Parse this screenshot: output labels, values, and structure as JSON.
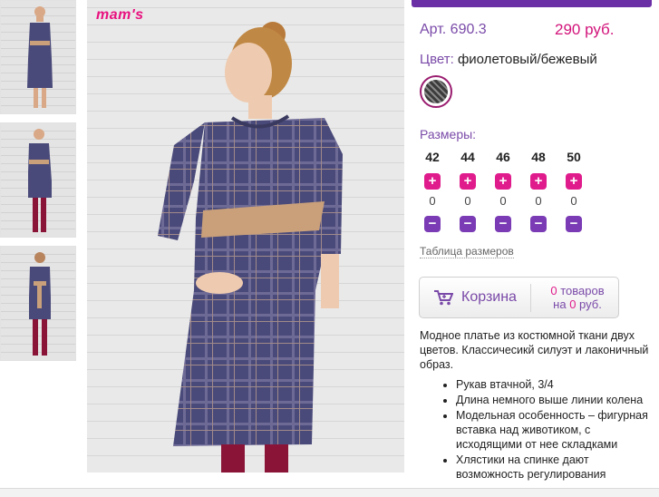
{
  "brand": {
    "logo_text": "mam's"
  },
  "product": {
    "article": "Арт. 690.3",
    "price": "290 руб.",
    "color_label": "Цвет:",
    "color_value": "фиолетовый/бежевый",
    "sizes_label": "Размеры:",
    "size_table_link": "Таблица размеров"
  },
  "sizes": [
    {
      "size": "42",
      "qty": "0"
    },
    {
      "size": "44",
      "qty": "0"
    },
    {
      "size": "46",
      "qty": "0"
    },
    {
      "size": "48",
      "qty": "0"
    },
    {
      "size": "50",
      "qty": "0"
    }
  ],
  "buttons": {
    "plus": "+",
    "minus": "−"
  },
  "cart": {
    "label": "Корзина",
    "count_num": "0",
    "count_text": " товаров",
    "sum_prefix": "на ",
    "sum_num": "0",
    "sum_suffix": " руб."
  },
  "description": {
    "intro": "Модное платье из костюмной ткани двух цветов. Классичесикй силуэт и лаконичный образ.",
    "bullets": [
      "Рукав втачной, 3/4",
      "Длина немного выше линии колена",
      "Модельная особенность – фигурная вставка над животиком, с исходящими от нее складками",
      "Хлястики на спинке дают возможность регулирования"
    ]
  },
  "colors": {
    "accent_purple": "#7a4aa8",
    "accent_pink": "#e01c8c",
    "dress": "#4a4a7a",
    "belt": "#c9a07a"
  }
}
